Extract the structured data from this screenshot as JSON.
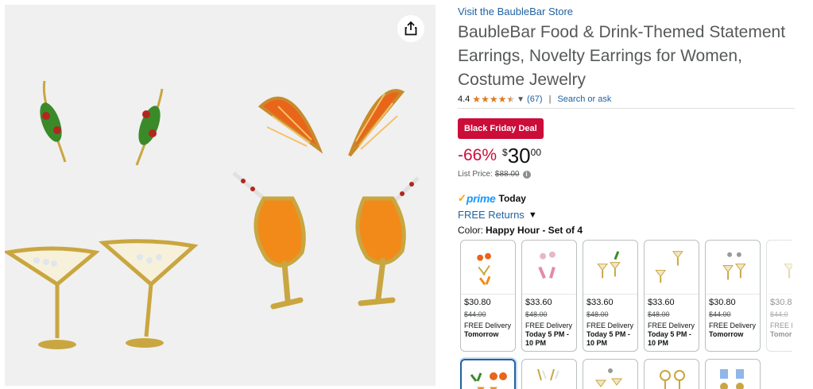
{
  "store": {
    "link_text": "Visit the BaubleBar Store"
  },
  "product": {
    "title": "BaubleBar Food & Drink-Themed Statement Earrings, Novelty Earrings for Women, Costume Jewelry",
    "rating_value": "4.4",
    "stars": 4.5,
    "rating_count": "(67)",
    "separator": "|",
    "search_label": "Search or ask"
  },
  "deal": {
    "badge": "Black Friday Deal"
  },
  "price": {
    "discount": "-66%",
    "symbol": "$",
    "whole": "30",
    "fraction": "00",
    "list_label": "List Price:",
    "list_value": "$88.00",
    "info_glyph": "i"
  },
  "delivery": {
    "check": "✓",
    "prime": "prime",
    "prime_day": "Today",
    "returns": "FREE Returns"
  },
  "color": {
    "label": "Color:",
    "value": "Happy Hour - Set of 4"
  },
  "swatches": [
    {
      "price": "$30.80",
      "old": "$44.00",
      "del_label": "FREE Delivery",
      "del_when": "Tomorrow"
    },
    {
      "price": "$33.60",
      "old": "$48.00",
      "del_label": "FREE Delivery",
      "del_when": "Today 5 PM - 10 PM"
    },
    {
      "price": "$33.60",
      "old": "$48.00",
      "del_label": "FREE Delivery",
      "del_when": "Today 5 PM - 10 PM"
    },
    {
      "price": "$33.60",
      "old": "$48.00",
      "del_label": "FREE Delivery",
      "del_when": "Today 5 PM - 10 PM"
    },
    {
      "price": "$30.80",
      "old": "$44.00",
      "del_label": "FREE Delivery",
      "del_when": "Tomorrow"
    },
    {
      "price": "$30.8",
      "old": "$44.0",
      "del_label": "FREE D",
      "del_when": "Tomor"
    }
  ],
  "icons": {
    "share": "share-icon",
    "chevron": "chevron-down-icon",
    "info": "info-icon"
  },
  "colors": {
    "link": "#2162a1",
    "deal_red": "#cc0c39",
    "star": "#de7921",
    "prime_blue": "#1a98ff",
    "prime_orange": "#ff9900"
  }
}
